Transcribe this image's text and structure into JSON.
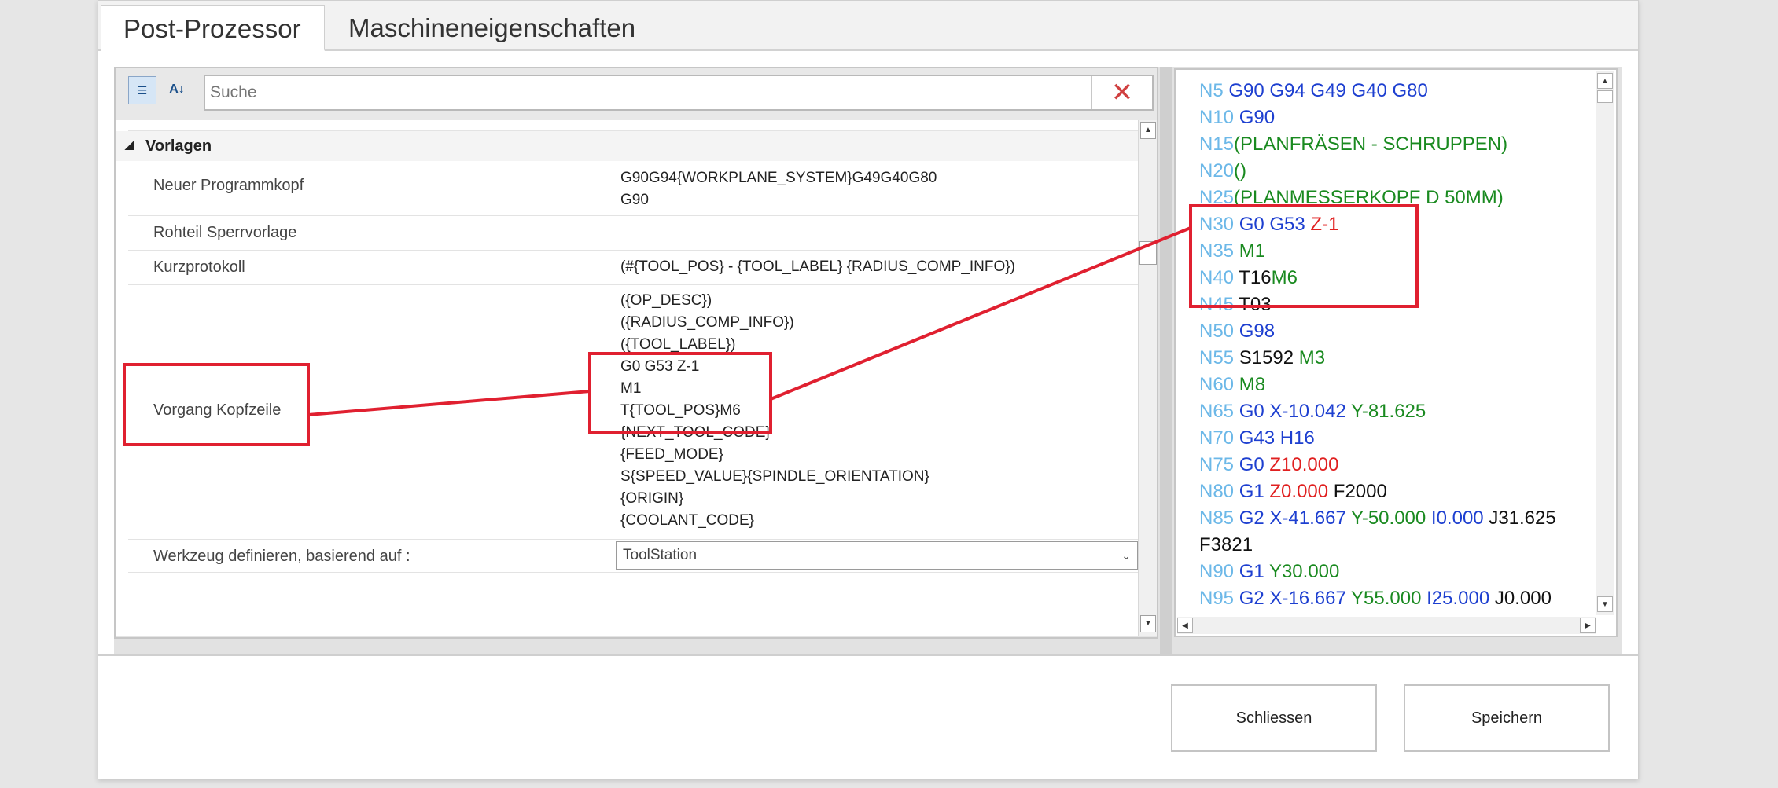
{
  "tabs": [
    {
      "label": "Post-Prozessor"
    },
    {
      "label": "Maschineneigenschaften"
    }
  ],
  "toolbar": {
    "categorized_icon": "categorized-view-icon",
    "alpha_icon": "sort-alphabetical-icon",
    "alpha_label": "A↓",
    "search_placeholder": "Suche",
    "clear_icon": "✕"
  },
  "grid": {
    "group_label": "Vorlagen",
    "rows": [
      {
        "name": "Neuer Programmkopf",
        "value_lines": [
          "G90G94{WORKPLANE_SYSTEM}G49G40G80",
          "G90"
        ]
      },
      {
        "name": "Rohteil Sperrvorlage",
        "value_lines": []
      },
      {
        "name": "Kurzprotokoll",
        "value_lines": [
          "(#{TOOL_POS} - {TOOL_LABEL} {RADIUS_COMP_INFO})"
        ]
      },
      {
        "name": "Vorgang Kopfzeile",
        "value_lines": [
          "({OP_DESC})",
          "({RADIUS_COMP_INFO})",
          "({TOOL_LABEL})",
          "G0 G53 Z-1",
          "M1",
          "T{TOOL_POS}M6",
          "{NEXT_TOOL_CODE}",
          "{FEED_MODE}",
          "S{SPEED_VALUE}{SPINDLE_ORIENTATION}",
          "{ORIGIN}",
          "{COOLANT_CODE}"
        ]
      },
      {
        "name": "Werkzeug definieren, basierend auf :",
        "select_value": "ToolStation"
      }
    ]
  },
  "code_preview": {
    "colors": {
      "line_number": "#6cb8e8",
      "g_code": "#1d3fd0",
      "m_code": "#1a8a20",
      "comment": "#1a8a20",
      "z": "#e02020",
      "x": "#1d3fd0",
      "y": "#1a8a20",
      "plain": "#111111"
    },
    "lines": [
      [
        {
          "t": "N5 ",
          "c": "line_number"
        },
        {
          "t": "G90 G94 G49 G40 G80",
          "c": "g_code"
        }
      ],
      [
        {
          "t": "N10 ",
          "c": "line_number"
        },
        {
          "t": "G90",
          "c": "g_code"
        }
      ],
      [
        {
          "t": "N15",
          "c": "line_number"
        },
        {
          "t": "(PLANFRÄSEN - SCHRUPPEN)",
          "c": "comment"
        }
      ],
      [
        {
          "t": "N20",
          "c": "line_number"
        },
        {
          "t": "()",
          "c": "comment"
        }
      ],
      [
        {
          "t": "N25",
          "c": "line_number"
        },
        {
          "t": "(PLANMESSERKOPF D 50MM)",
          "c": "comment"
        }
      ],
      [
        {
          "t": "N30 ",
          "c": "line_number"
        },
        {
          "t": "G0 G53 ",
          "c": "g_code"
        },
        {
          "t": "Z-1",
          "c": "z"
        }
      ],
      [
        {
          "t": "N35 ",
          "c": "line_number"
        },
        {
          "t": "M1",
          "c": "m_code"
        }
      ],
      [
        {
          "t": "N40 ",
          "c": "line_number"
        },
        {
          "t": "T16",
          "c": "plain"
        },
        {
          "t": "M6",
          "c": "m_code"
        }
      ],
      [
        {
          "t": "N45 ",
          "c": "line_number"
        },
        {
          "t": "T03",
          "c": "plain"
        }
      ],
      [
        {
          "t": "N50 ",
          "c": "line_number"
        },
        {
          "t": "G98",
          "c": "g_code"
        }
      ],
      [
        {
          "t": "N55 ",
          "c": "line_number"
        },
        {
          "t": "S1592 ",
          "c": "plain"
        },
        {
          "t": "M3",
          "c": "m_code"
        }
      ],
      [
        {
          "t": "N60 ",
          "c": "line_number"
        },
        {
          "t": "M8",
          "c": "m_code"
        }
      ],
      [
        {
          "t": "N65 ",
          "c": "line_number"
        },
        {
          "t": "G0 X-10.042 ",
          "c": "x"
        },
        {
          "t": "Y-81.625",
          "c": "y"
        }
      ],
      [
        {
          "t": "N70 ",
          "c": "line_number"
        },
        {
          "t": "G43 H16",
          "c": "g_code"
        }
      ],
      [
        {
          "t": "N75 ",
          "c": "line_number"
        },
        {
          "t": "G0 ",
          "c": "g_code"
        },
        {
          "t": "Z10.000",
          "c": "z"
        }
      ],
      [
        {
          "t": "N80 ",
          "c": "line_number"
        },
        {
          "t": "G1 ",
          "c": "g_code"
        },
        {
          "t": "Z0.000 ",
          "c": "z"
        },
        {
          "t": "F2000",
          "c": "plain"
        }
      ],
      [
        {
          "t": "N85 ",
          "c": "line_number"
        },
        {
          "t": "G2 X-41.667 ",
          "c": "x"
        },
        {
          "t": "Y-50.000 ",
          "c": "y"
        },
        {
          "t": "I0.000 ",
          "c": "g_code"
        },
        {
          "t": "J31.625",
          "c": "plain"
        }
      ],
      [
        {
          "t": "F3821",
          "c": "plain"
        }
      ],
      [
        {
          "t": "N90 ",
          "c": "line_number"
        },
        {
          "t": "G1 ",
          "c": "g_code"
        },
        {
          "t": "Y30.000",
          "c": "y"
        }
      ],
      [
        {
          "t": "N95 ",
          "c": "line_number"
        },
        {
          "t": "G2 X-16.667 ",
          "c": "x"
        },
        {
          "t": "Y55.000 ",
          "c": "y"
        },
        {
          "t": "I25.000 ",
          "c": "g_code"
        },
        {
          "t": "J0.000",
          "c": "plain"
        }
      ]
    ]
  },
  "footer": {
    "close_label": "Schliessen",
    "save_label": "Speichern"
  },
  "annotation_color": "#e02030"
}
